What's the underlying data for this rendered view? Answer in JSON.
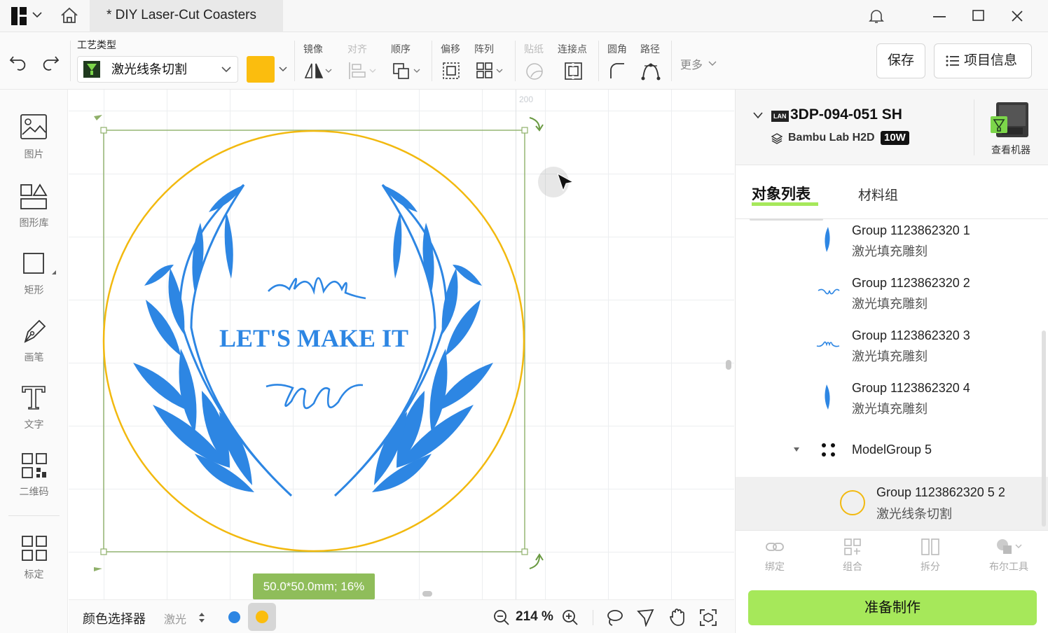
{
  "window": {
    "title": "* DIY Laser-Cut Coasters"
  },
  "toolbar": {
    "process_type_label": "工艺类型",
    "process_value": "激光线条切割",
    "process_color": "#fbbd0e",
    "groups": {
      "mirror": "镜像",
      "align": "对齐",
      "order": "顺序",
      "offset": "偏移",
      "array": "阵列",
      "sticker": "贴纸",
      "bridge": "连接点",
      "fillet": "圆角",
      "path": "路径",
      "more": "更多"
    },
    "save_label": "保存",
    "project_info_label": "项目信息"
  },
  "sidebar": {
    "items": [
      {
        "label": "图片",
        "icon": "image-icon"
      },
      {
        "label": "图形库",
        "icon": "shape-library-icon"
      },
      {
        "label": "矩形",
        "icon": "rectangle-icon"
      },
      {
        "label": "画笔",
        "icon": "pen-icon"
      },
      {
        "label": "文字",
        "icon": "text-icon"
      },
      {
        "label": "二维码",
        "icon": "qrcode-icon"
      },
      {
        "label": "标定",
        "icon": "calibrate-icon"
      }
    ]
  },
  "canvas": {
    "ruler_mark": "200",
    "design_text": "LET'S MAKE IT",
    "size_badge": "50.0*50.0mm; 16%",
    "colors": {
      "laurel": "#2d86e3",
      "circle": "#f2b90f",
      "selection": "#8fb06a"
    }
  },
  "bottombar": {
    "color_picker_label": "颜色选择器",
    "mode": "激光",
    "zoom": "214 %",
    "swatches": [
      "#2d86e3",
      "#fbbd0e"
    ]
  },
  "machine": {
    "name": "3DP-094-051 SH",
    "connection": "LAN",
    "model": "Bambu Lab H2D",
    "power": "10W",
    "view_machine_label": "查看机器"
  },
  "panel": {
    "tabs": [
      "对象列表",
      "材料组"
    ],
    "objects": [
      {
        "name": "Group 1123862320 1",
        "sub": "激光填充雕刻"
      },
      {
        "name": "Group 1123862320 2",
        "sub": "激光填充雕刻"
      },
      {
        "name": "Group 1123862320 3",
        "sub": "激光填充雕刻"
      },
      {
        "name": "Group 1123862320 4",
        "sub": "激光填充雕刻"
      },
      {
        "name": "ModelGroup 5",
        "sub": ""
      },
      {
        "name": "Group 1123862320 5 2",
        "sub": "激光线条切割"
      }
    ],
    "actions": [
      "绑定",
      "组合",
      "拆分",
      "布尔工具"
    ],
    "prepare_label": "准备制作"
  }
}
